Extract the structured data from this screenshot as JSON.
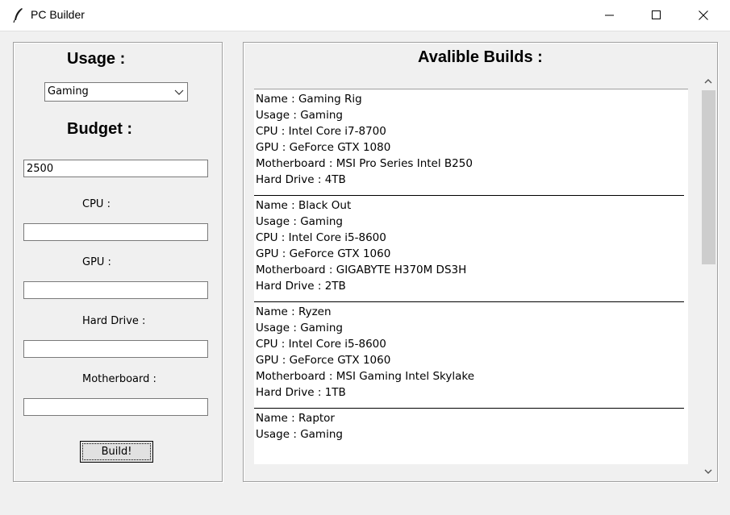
{
  "window": {
    "title": "PC Builder",
    "icon": "feather-icon"
  },
  "left": {
    "usage_heading": "Usage :",
    "usage_selected": "Gaming",
    "budget_heading": "Budget :",
    "budget_value": "2500",
    "cpu_label": "CPU :",
    "cpu_value": "",
    "gpu_label": "GPU :",
    "gpu_value": "",
    "hdd_label": "Hard Drive :",
    "hdd_value": "",
    "mobo_label": "Motherboard :",
    "mobo_value": "",
    "build_button": "Build!"
  },
  "right": {
    "heading": "Avalible Builds :",
    "builds": [
      {
        "name": "Name : Gaming Rig",
        "usage": "Usage : Gaming",
        "cpu": "CPU : Intel Core i7-8700",
        "gpu": "GPU : GeForce GTX 1080",
        "mobo": "Motherboard : MSI Pro Series Intel B250",
        "hdd": "Hard Drive : 4TB"
      },
      {
        "name": "Name : Black Out",
        "usage": "Usage : Gaming",
        "cpu": "CPU : Intel Core i5-8600",
        "gpu": "GPU : GeForce GTX 1060",
        "mobo": "Motherboard : GIGABYTE H370M DS3H",
        "hdd": "Hard Drive : 2TB"
      },
      {
        "name": "Name : Ryzen",
        "usage": "Usage : Gaming",
        "cpu": "CPU : Intel Core i5-8600",
        "gpu": "GPU : GeForce GTX 1060",
        "mobo": "Motherboard : MSI Gaming Intel Skylake",
        "hdd": "Hard Drive : 1TB"
      },
      {
        "name": "Name : Raptor",
        "usage": "Usage : Gaming",
        "cpu": "",
        "gpu": "",
        "mobo": "",
        "hdd": ""
      }
    ]
  }
}
